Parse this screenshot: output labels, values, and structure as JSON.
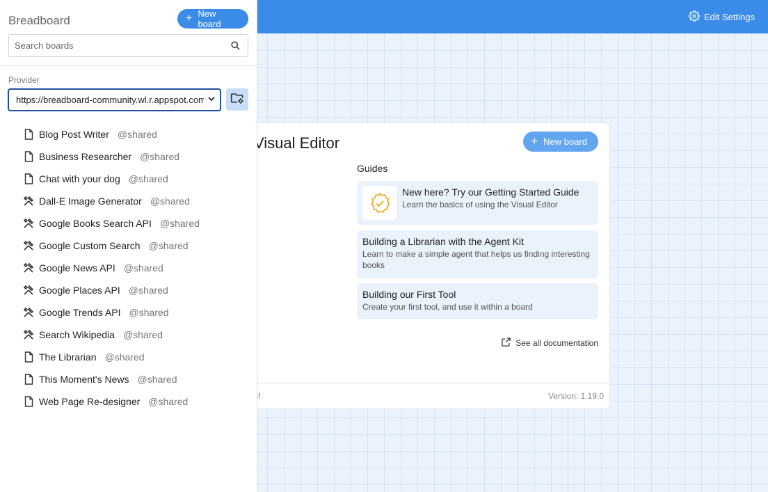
{
  "app": {
    "title": "Breadboard"
  },
  "header": {
    "edit_settings_label": "Edit Settings"
  },
  "sidebar": {
    "new_board_label": "New board",
    "search": {
      "placeholder": "Search boards",
      "value": ""
    },
    "provider": {
      "label": "Provider",
      "selected": "https://breadboard-community.wl.r.appspot.com"
    },
    "boards": [
      {
        "name": "Blog Post Writer",
        "tag": "@shared",
        "icon": "file-icon"
      },
      {
        "name": "Business Researcher",
        "tag": "@shared",
        "icon": "file-icon"
      },
      {
        "name": "Chat with your dog",
        "tag": "@shared",
        "icon": "file-icon"
      },
      {
        "name": "Dall-E Image Generator",
        "tag": "@shared",
        "icon": "tool-icon"
      },
      {
        "name": "Google Books Search API",
        "tag": "@shared",
        "icon": "tool-icon"
      },
      {
        "name": "Google Custom Search",
        "tag": "@shared",
        "icon": "tool-icon"
      },
      {
        "name": "Google News API",
        "tag": "@shared",
        "icon": "tool-icon"
      },
      {
        "name": "Google Places API",
        "tag": "@shared",
        "icon": "tool-icon"
      },
      {
        "name": "Google Trends API",
        "tag": "@shared",
        "icon": "tool-icon"
      },
      {
        "name": "Search Wikipedia",
        "tag": "@shared",
        "icon": "tool-icon"
      },
      {
        "name": "The Librarian",
        "tag": "@shared",
        "icon": "file-icon"
      },
      {
        "name": "This Moment's News",
        "tag": "@shared",
        "icon": "file-icon"
      },
      {
        "name": "Web Page Re-designer",
        "tag": "@shared",
        "icon": "file-icon"
      }
    ]
  },
  "welcome": {
    "title": "Visual Editor",
    "new_board_label": "New board",
    "guides_heading": "Guides",
    "guides": [
      {
        "title": "New here? Try our Getting Started Guide",
        "description": "Learn the basics of using the Visual Editor"
      },
      {
        "title": "Building a Librarian with the Agent Kit",
        "description": "Learn to make a simple agent that helps us finding interesting books"
      },
      {
        "title": "Building our First Tool",
        "description": "Create your first tool, and use it within a board"
      }
    ],
    "see_all_label": "See all documentation",
    "footer_fragment": "s!",
    "version": "Version: 1.19.0"
  },
  "colors": {
    "header": "#3b8be8",
    "accent": "#5aa2f0",
    "badge": "#e7b73a",
    "canvas": "#eaf2fc"
  }
}
